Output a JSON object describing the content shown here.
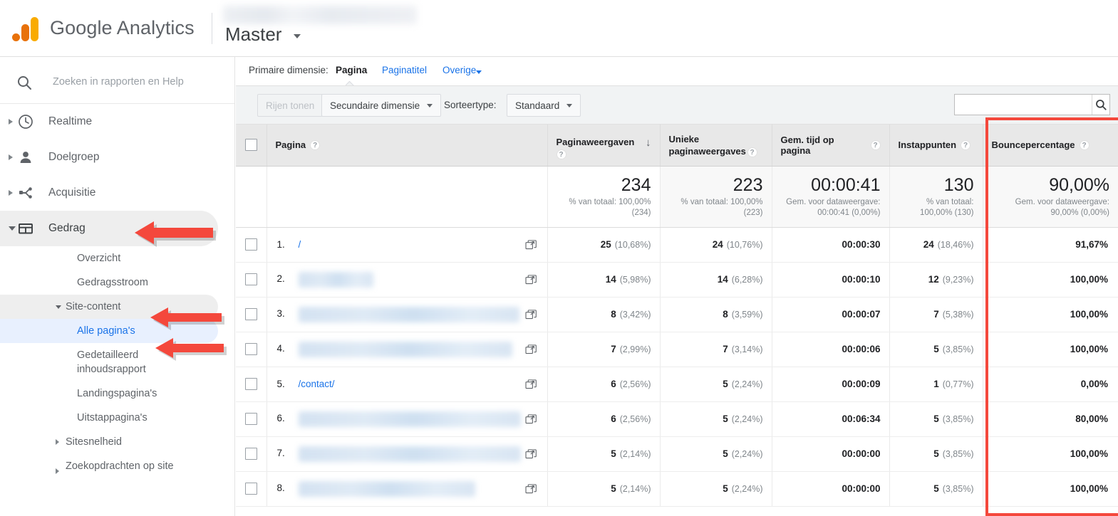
{
  "app": {
    "brand": "Google Analytics",
    "view_name": "Master",
    "logo_icon": "google-analytics-logo",
    "view_caret_icon": "chevron-down-icon"
  },
  "sidebar": {
    "search": {
      "placeholder": "Zoeken in rapporten en Help",
      "value": "",
      "icon": "search-icon"
    },
    "items": [
      {
        "label": "Realtime",
        "icon": "clock-icon",
        "expanded": false,
        "selected": false
      },
      {
        "label": "Doelgroep",
        "icon": "person-icon",
        "expanded": false,
        "selected": false
      },
      {
        "label": "Acquisitie",
        "icon": "share-nodes-icon",
        "expanded": false,
        "selected": false
      },
      {
        "label": "Gedrag",
        "icon": "behavior-panel-icon",
        "expanded": true,
        "selected": true
      }
    ],
    "sub_items": [
      {
        "label": "Overzicht",
        "type": "leaf",
        "active": false
      },
      {
        "label": "Gedragsstroom",
        "type": "leaf",
        "active": false
      },
      {
        "label": "Site-content",
        "type": "group",
        "expanded": true,
        "selected": true
      },
      {
        "label": "Alle pagina's",
        "type": "leaf",
        "active": true,
        "indent": 2
      },
      {
        "label": "Gedetailleerd inhoudsrapport",
        "type": "leaf",
        "active": false,
        "indent": 2
      },
      {
        "label": "Landingspagina's",
        "type": "leaf",
        "active": false,
        "indent": 2
      },
      {
        "label": "Uitstappagina's",
        "type": "leaf",
        "active": false,
        "indent": 2
      },
      {
        "label": "Sitesnelheid",
        "type": "group",
        "expanded": false,
        "selected": false
      },
      {
        "label": "Zoekopdrachten op site",
        "type": "group",
        "expanded": false,
        "selected": false
      }
    ]
  },
  "annotations": {
    "arrow_color": "#f4483c",
    "highlight_color": "#f4483c",
    "arrows": [
      {
        "target": "Gedrag"
      },
      {
        "target": "Site-content"
      },
      {
        "target": "Alle pagina's"
      }
    ],
    "highlight_box_target": "Bouncepercentage"
  },
  "dimension_bar": {
    "label": "Primaire dimensie:",
    "primary": "Pagina",
    "alternate": "Paginatitel",
    "other": "Overige",
    "other_caret_icon": "chevron-down-icon"
  },
  "controls": {
    "show_rows": "Rijen tonen",
    "secondary_dimension": "Secundaire dimensie",
    "sort_type_label": "Sorteertype:",
    "sort_type_value": "Standaard",
    "table_search": {
      "value": "",
      "placeholder": "",
      "icon": "search-icon"
    }
  },
  "table": {
    "select_all_icon": "checkbox-icon",
    "help_icon": "question-mark-icon",
    "sort_icon": "arrow-down-icon",
    "row_external_icon": "open-in-new-icon",
    "columns": [
      {
        "label": "Pagina",
        "help": true,
        "sorted": false
      },
      {
        "label": "Paginaweergaven",
        "help": true,
        "sorted": true
      },
      {
        "label": "Unieke paginaweergaves",
        "help": true,
        "sorted": false
      },
      {
        "label": "Gem. tijd op pagina",
        "help": true,
        "sorted": false
      },
      {
        "label": "Instappunten",
        "help": true,
        "sorted": false
      },
      {
        "label": "Bouncepercentage",
        "help": true,
        "sorted": false
      }
    ],
    "summary": [
      {
        "value": "234",
        "sub": "% van totaal: 100,00% (234)"
      },
      {
        "value": "223",
        "sub": "% van totaal: 100,00% (223)"
      },
      {
        "value": "00:00:41",
        "sub": "Gem. voor dataweergave: 00:00:41 (0,00%)"
      },
      {
        "value": "130",
        "sub": "% van totaal: 100,00% (130)"
      },
      {
        "value": "90,00%",
        "sub": "Gem. voor dataweergave: 90,00% (0,00%)"
      }
    ],
    "rows": [
      {
        "index": "1.",
        "page": "/",
        "redacted": false,
        "blur_width": 0,
        "pageviews": "25",
        "pageviews_pct": "(10,68%)",
        "unique": "24",
        "unique_pct": "(10,76%)",
        "avg_time": "00:00:30",
        "entrances": "24",
        "entrances_pct": "(18,46%)",
        "bounce": "91,67%"
      },
      {
        "index": "2.",
        "page": "",
        "redacted": true,
        "blur_width": 105,
        "pageviews": "14",
        "pageviews_pct": "(5,98%)",
        "unique": "14",
        "unique_pct": "(6,28%)",
        "avg_time": "00:00:10",
        "entrances": "12",
        "entrances_pct": "(9,23%)",
        "bounce": "100,00%"
      },
      {
        "index": "3.",
        "page": "",
        "redacted": true,
        "blur_width": 310,
        "pageviews": "8",
        "pageviews_pct": "(3,42%)",
        "unique": "8",
        "unique_pct": "(3,59%)",
        "avg_time": "00:00:07",
        "entrances": "7",
        "entrances_pct": "(5,38%)",
        "bounce": "100,00%"
      },
      {
        "index": "4.",
        "page": "",
        "redacted": true,
        "blur_width": 300,
        "pageviews": "7",
        "pageviews_pct": "(2,99%)",
        "unique": "7",
        "unique_pct": "(3,14%)",
        "avg_time": "00:00:06",
        "entrances": "5",
        "entrances_pct": "(3,85%)",
        "bounce": "100,00%"
      },
      {
        "index": "5.",
        "page": "/contact/",
        "redacted": false,
        "blur_width": 0,
        "pageviews": "6",
        "pageviews_pct": "(2,56%)",
        "unique": "5",
        "unique_pct": "(2,24%)",
        "avg_time": "00:00:09",
        "entrances": "1",
        "entrances_pct": "(0,77%)",
        "bounce": "0,00%"
      },
      {
        "index": "6.",
        "page": "",
        "redacted": true,
        "blur_width": 312,
        "pageviews": "6",
        "pageviews_pct": "(2,56%)",
        "unique": "5",
        "unique_pct": "(2,24%)",
        "avg_time": "00:06:34",
        "entrances": "5",
        "entrances_pct": "(3,85%)",
        "bounce": "80,00%"
      },
      {
        "index": "7.",
        "page": "",
        "redacted": true,
        "blur_width": 312,
        "pageviews": "5",
        "pageviews_pct": "(2,14%)",
        "unique": "5",
        "unique_pct": "(2,24%)",
        "avg_time": "00:00:00",
        "entrances": "5",
        "entrances_pct": "(3,85%)",
        "bounce": "100,00%"
      },
      {
        "index": "8.",
        "page": "",
        "redacted": true,
        "blur_width": 248,
        "pageviews": "5",
        "pageviews_pct": "(2,14%)",
        "unique": "5",
        "unique_pct": "(2,24%)",
        "avg_time": "00:00:00",
        "entrances": "5",
        "entrances_pct": "(3,85%)",
        "bounce": "100,00%"
      }
    ]
  }
}
